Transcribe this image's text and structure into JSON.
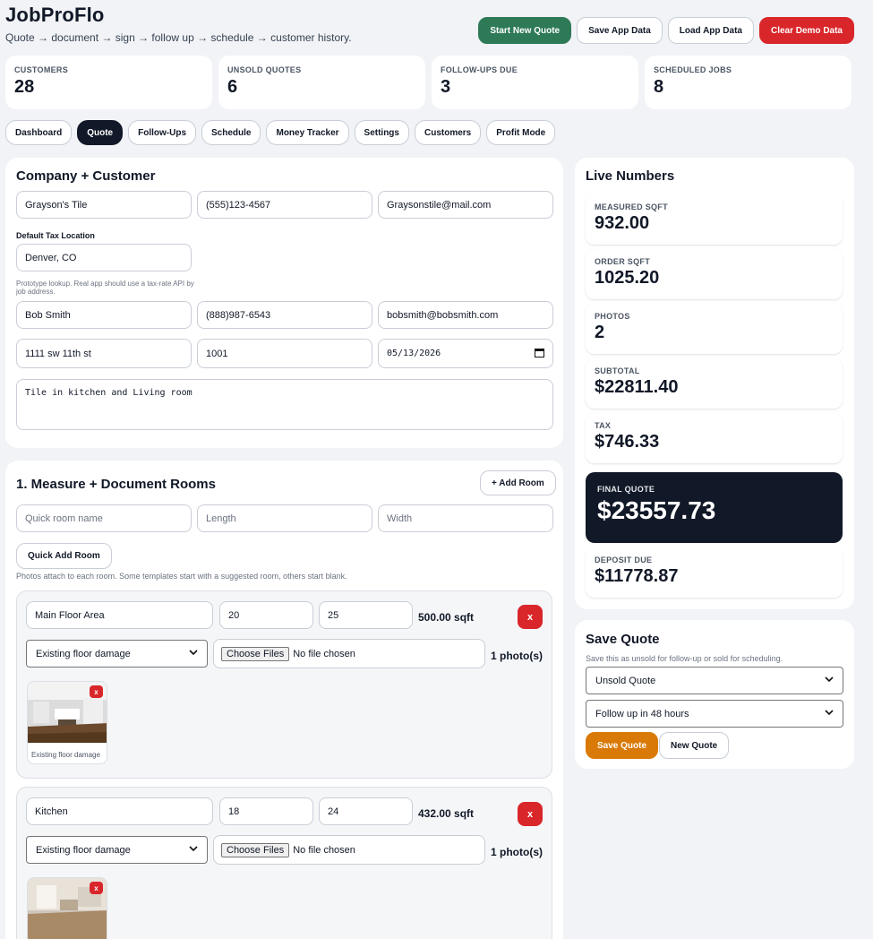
{
  "app": {
    "title": "JobProFlo",
    "subtitle": "Quote → document → sign → follow up → schedule → customer history."
  },
  "actions": {
    "start_new_quote": "Start New Quote",
    "save_app_data": "Save App Data",
    "load_app_data": "Load App Data",
    "clear_demo_data": "Clear Demo Data"
  },
  "stats": [
    {
      "label": "Customers",
      "value": "28"
    },
    {
      "label": "Unsold Quotes",
      "value": "6"
    },
    {
      "label": "Follow-Ups Due",
      "value": "3"
    },
    {
      "label": "Scheduled Jobs",
      "value": "8"
    }
  ],
  "tabs": [
    "Dashboard",
    "Quote",
    "Follow-Ups",
    "Schedule",
    "Money Tracker",
    "Settings",
    "Customers",
    "Profit Mode"
  ],
  "active_tab": "Quote",
  "company_customer": {
    "title": "Company + Customer",
    "company_name": "Grayson's Tile",
    "company_phone": "(555)123-4567",
    "company_email": "Graysonstile@mail.com",
    "tax_location_label": "Default Tax Location",
    "tax_location": "Denver, CO",
    "tax_note": "Prototype lookup. Real app should use a tax-rate API by job address.",
    "customer_name": "Bob Smith",
    "customer_phone": "(888)987-6543",
    "customer_email": "bobsmith@bobsmith.com",
    "address": "1111 sw 11th st",
    "unit": "1001",
    "date": "05/13/2026",
    "notes": "Tile in kitchen and Living room"
  },
  "measure": {
    "title": "1. Measure + Document Rooms",
    "add_room": "+ Add Room",
    "quick_room_placeholder": "Quick room name",
    "length_placeholder": "Length",
    "width_placeholder": "Width",
    "quick_add": "Quick Add Room",
    "hint": "Photos attach to each room. Some templates start with a suggested room, others start blank.",
    "rooms": [
      {
        "name": "Main Floor Area",
        "length": "20",
        "width": "25",
        "sqft": "500.00 sqft",
        "category": "Existing floor damage",
        "file_btn": "Choose Files",
        "file_status": "No file chosen",
        "photos": "1 photo(s)",
        "caption": "Existing floor damage"
      },
      {
        "name": "Kitchen",
        "length": "18",
        "width": "24",
        "sqft": "432.00 sqft",
        "category": "Existing floor damage",
        "file_btn": "Choose Files",
        "file_status": "No file chosen",
        "photos": "1 photo(s)",
        "caption": ""
      }
    ]
  },
  "live": {
    "title": "Live Numbers",
    "metrics": [
      {
        "label": "Measured SQFT",
        "value": "932.00"
      },
      {
        "label": "Order SQFT",
        "value": "1025.20"
      },
      {
        "label": "Photos",
        "value": "2"
      },
      {
        "label": "Subtotal",
        "value": "$22811.40"
      },
      {
        "label": "Tax",
        "value": "$746.33"
      }
    ],
    "final_label": "Final Quote",
    "final_value": "$23557.73",
    "deposit_label": "Deposit Due",
    "deposit_value": "$11778.87"
  },
  "save_quote": {
    "title": "Save Quote",
    "hint": "Save this as unsold for follow-up or sold for scheduling.",
    "status": "Unsold Quote",
    "follow_up": "Follow up in 48 hours",
    "save_btn": "Save Quote",
    "new_btn": "New Quote"
  },
  "icons": {
    "remove": "x",
    "select_arrow": "chevron-down-icon",
    "date": "calendar-icon"
  }
}
